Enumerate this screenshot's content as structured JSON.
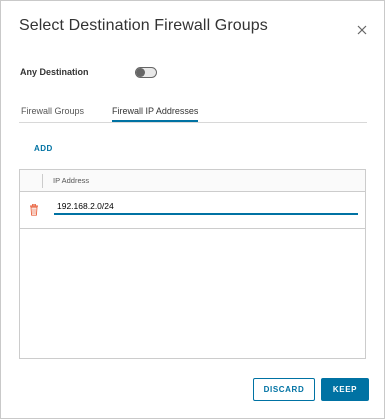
{
  "dialog": {
    "title": "Select Destination Firewall Groups",
    "close_icon": "close-icon"
  },
  "any_destination": {
    "label": "Any Destination",
    "toggle_on": false
  },
  "tabs": [
    {
      "label": "Firewall Groups",
      "active": false
    },
    {
      "label": "Firewall IP Addresses",
      "active": true
    }
  ],
  "add_label": "ADD",
  "grid": {
    "columns": [
      "IP Address"
    ],
    "rows": [
      {
        "ip_address": "192.168.2.0/24",
        "delete_icon": "trash-icon"
      }
    ]
  },
  "footer": {
    "discard_label": "DISCARD",
    "keep_label": "KEEP"
  },
  "colors": {
    "accent": "#0072a3",
    "delete": "#e8603c"
  }
}
